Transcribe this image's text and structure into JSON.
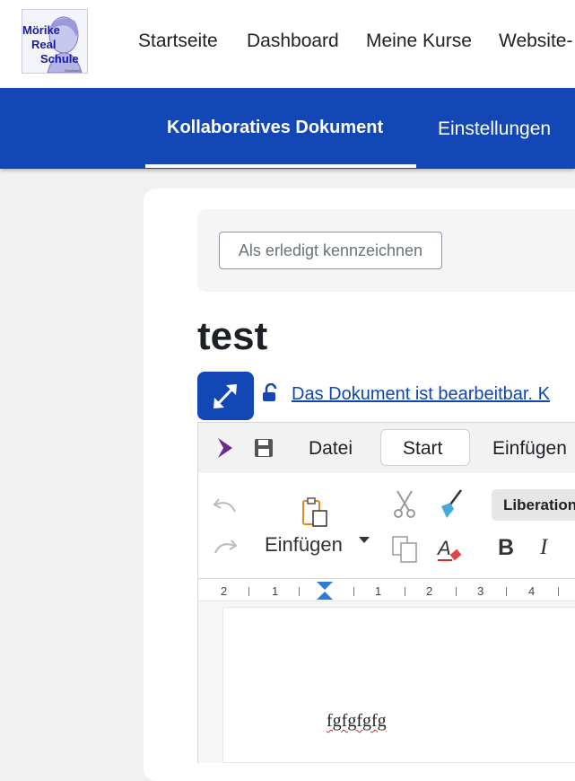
{
  "logo": {
    "line1": "Mörike",
    "line2": "Real",
    "line3": "Schule",
    "tagline": "Waldstadt"
  },
  "nav": {
    "items": [
      "Startseite",
      "Dashboard",
      "Meine Kurse",
      "Website-"
    ]
  },
  "tabs": {
    "active": "Kollaboratives Dokument",
    "settings": "Einstellungen"
  },
  "completion": {
    "button_label": "Als erledigt kennzeichnen"
  },
  "page": {
    "title": "test"
  },
  "editable_notice": "Das Dokument ist bearbeitbar. K",
  "editor": {
    "menu": {
      "file": "Datei",
      "start": "Start",
      "insert": "Einfügen"
    },
    "toolbar": {
      "paste_label": "Einfügen",
      "font_name": "Liberation",
      "bold": "B",
      "italic": "I"
    },
    "ruler": {
      "labels": [
        "2",
        "1",
        "1",
        "2",
        "3",
        "4"
      ]
    },
    "document_text": "fgfgfgfg"
  },
  "colors": {
    "brand_blue": "#1347b5",
    "app_purple": "#6b2a8c",
    "spell_error": "#dd2222"
  }
}
